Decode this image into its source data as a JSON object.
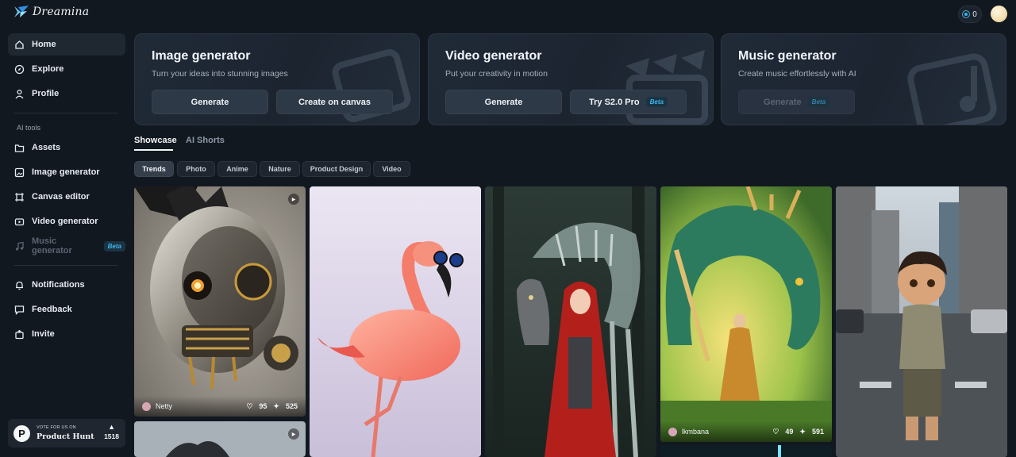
{
  "app": {
    "name": "Dreamina",
    "credits": "0"
  },
  "sidebar": {
    "items": [
      {
        "label": "Home"
      },
      {
        "label": "Explore"
      },
      {
        "label": "Profile"
      }
    ],
    "section_label": "AI tools",
    "tools": [
      {
        "label": "Assets"
      },
      {
        "label": "Image generator"
      },
      {
        "label": "Canvas editor"
      },
      {
        "label": "Video generator"
      },
      {
        "label": "Music generator",
        "badge": "Beta"
      }
    ],
    "bottom": [
      {
        "label": "Notifications"
      },
      {
        "label": "Feedback"
      },
      {
        "label": "Invite"
      }
    ],
    "product_hunt": {
      "small": "VOTE FOR US ON",
      "big": "Product Hunt",
      "votes": "1518"
    }
  },
  "generators": [
    {
      "title": "Image generator",
      "subtitle": "Turn your ideas into stunning images",
      "buttons": [
        "Generate",
        "Create on canvas"
      ]
    },
    {
      "title": "Video generator",
      "subtitle": "Put your creativity in motion",
      "buttons": [
        "Generate",
        "Try S2.0 Pro"
      ],
      "badge": "Beta"
    },
    {
      "title": "Music generator",
      "subtitle": "Create music effortlessly with AI",
      "buttons": [
        "Generate"
      ],
      "badge": "Beta"
    }
  ],
  "tabs": [
    "Showcase",
    "AI Shorts"
  ],
  "filters": [
    "Trends",
    "Photo",
    "Anime",
    "Nature",
    "Product Design",
    "Video"
  ],
  "gallery": [
    {
      "user": "Netty",
      "likes": "95",
      "remixes": "525"
    },
    {
      "user": "lkmbana",
      "likes": "49",
      "remixes": "591"
    }
  ],
  "colors": {
    "background": "#121820",
    "accent": "#3fb3e8"
  }
}
